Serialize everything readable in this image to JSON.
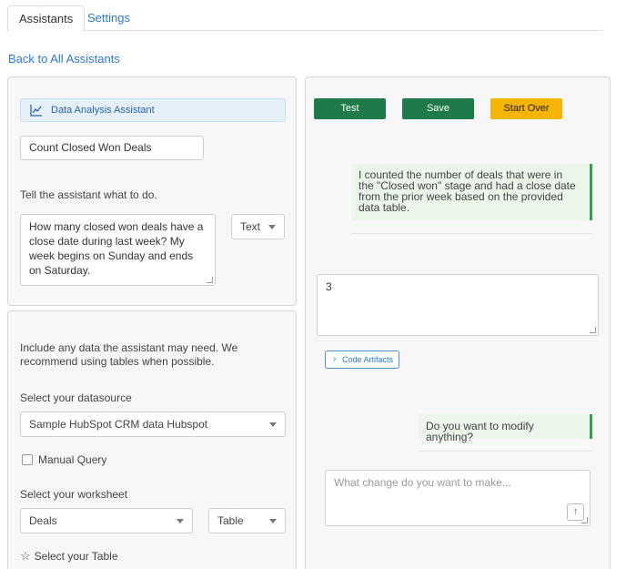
{
  "tabs": [
    {
      "label": "Assistants",
      "active": true
    },
    {
      "label": "Settings",
      "active": false
    }
  ],
  "back_link": "Back to All Assistants",
  "config": {
    "assistant_type": "Data Analysis Assistant",
    "assistant_type_icon": "line-chart-icon",
    "name_value": "Count Closed Won Deals",
    "instructions_label": "Tell the assistant what to do.",
    "instructions_value": "How many closed won deals have a close date during last week? My week begins on Sunday and ends on Saturday.",
    "output_format": "Text"
  },
  "data": {
    "intro": "Include any data the assistant may need. We recommend using tables when possible.",
    "datasource_label": "Select your datasource",
    "datasource_value": "Sample HubSpot CRM data Hubspot",
    "manual_query_label": "Manual Query",
    "manual_query_checked": false,
    "worksheet_label": "Select your worksheet",
    "worksheet_value": "Deals",
    "worksheet_type": "Table",
    "table_label": "Select your Table"
  },
  "chat": {
    "buttons": {
      "test": "Test",
      "save": "Save",
      "start_over": "Start Over"
    },
    "assistant_message": "I counted the number of deals that were in the \"Closed won\" stage and had a close date from the prior week based on the provided data table.",
    "result": "3",
    "code_artifacts_label": "Code Artifacts",
    "followup_message": "Do you want to modify anything?",
    "change_placeholder": "What change do you want to make..."
  },
  "colors": {
    "link": "#2b7bd6",
    "primary_button": "#1e7a48",
    "start_over_button": "#f4b400",
    "message_bg": "#eaf6ea",
    "message_accent": "#35a048"
  }
}
